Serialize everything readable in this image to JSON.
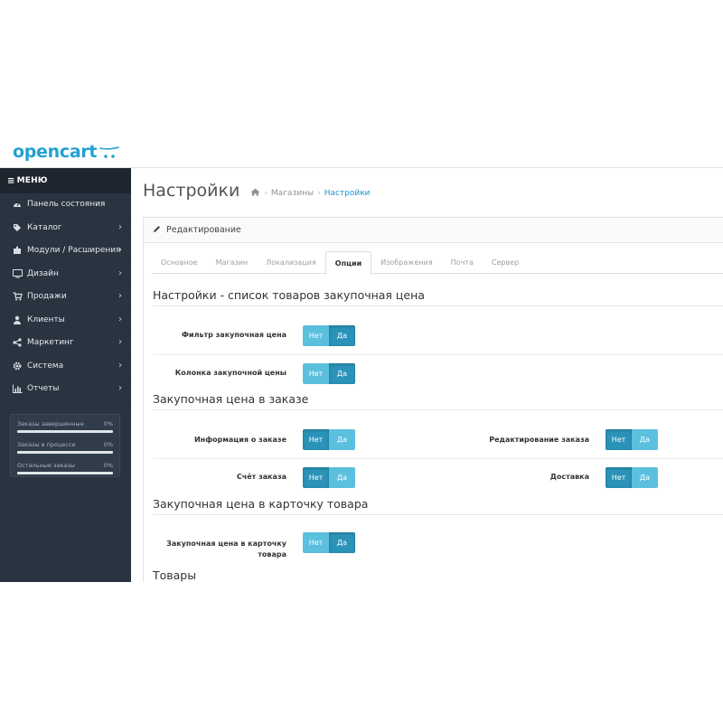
{
  "brand": {
    "logo_text": "opencart",
    "accent": "#23a1d1"
  },
  "sidebar": {
    "menu_label": "МЕНЮ",
    "items": [
      {
        "label": "Панель состояния",
        "icon": "dashboard-icon",
        "has_children": false
      },
      {
        "label": "Каталог",
        "icon": "tag-icon",
        "has_children": true
      },
      {
        "label": "Модули / Расширения",
        "icon": "puzzle-icon",
        "has_children": true
      },
      {
        "label": "Дизайн",
        "icon": "desktop-icon",
        "has_children": true
      },
      {
        "label": "Продажи",
        "icon": "cart-icon",
        "has_children": true
      },
      {
        "label": "Клиенты",
        "icon": "user-icon",
        "has_children": true
      },
      {
        "label": "Маркетинг",
        "icon": "share-icon",
        "has_children": true
      },
      {
        "label": "Система",
        "icon": "gear-icon",
        "has_children": true
      },
      {
        "label": "Отчеты",
        "icon": "bar-chart-icon",
        "has_children": true
      }
    ],
    "stats": [
      {
        "label": "Заказы завершенные",
        "value": "0%"
      },
      {
        "label": "Заказы в процессе",
        "value": "0%"
      },
      {
        "label": "Остальные заказы",
        "value": "0%"
      }
    ]
  },
  "header": {
    "title": "Настройки",
    "breadcrumbs": [
      "Магазины",
      "Настройки"
    ]
  },
  "panel": {
    "heading": "Редактирование",
    "tabs": [
      "Основное",
      "Магазин",
      "Локализация",
      "Опции",
      "Изображения",
      "Почта",
      "Сервер"
    ],
    "active_tab": "Опции"
  },
  "sections": [
    {
      "title": "Настройки - список товаров закупочная цена",
      "fields": [
        {
          "label": "Фильтр закупочная цена",
          "no": "Нет",
          "yes": "Да",
          "selected": "Да"
        },
        {
          "label": "Колонка закупочной цены",
          "no": "Нет",
          "yes": "Да",
          "selected": "Да"
        }
      ]
    },
    {
      "title": "Закупочная цена в заказе",
      "fields": [
        {
          "label": "Информация о заказе",
          "no": "Нет",
          "yes": "Да",
          "selected": "Нет"
        },
        {
          "label": "Редактирование заказа",
          "no": "Нет",
          "yes": "Да",
          "selected": "Нет"
        },
        {
          "label": "Счёт заказа",
          "no": "Нет",
          "yes": "Да",
          "selected": "Нет"
        },
        {
          "label": "Доставка",
          "no": "Нет",
          "yes": "Да",
          "selected": "Нет"
        }
      ]
    },
    {
      "title": "Закупочная цена в карточку товара",
      "fields": [
        {
          "label": "Закупочная цена в карточку товара",
          "no": "Нет",
          "yes": "Да",
          "selected": "Да"
        }
      ]
    },
    {
      "title": "Товары",
      "fields": []
    }
  ],
  "colors": {
    "toggle_light": "#5bc0de",
    "toggle_active": "#2b93b8",
    "sidebar_bg": "#2a3441"
  }
}
